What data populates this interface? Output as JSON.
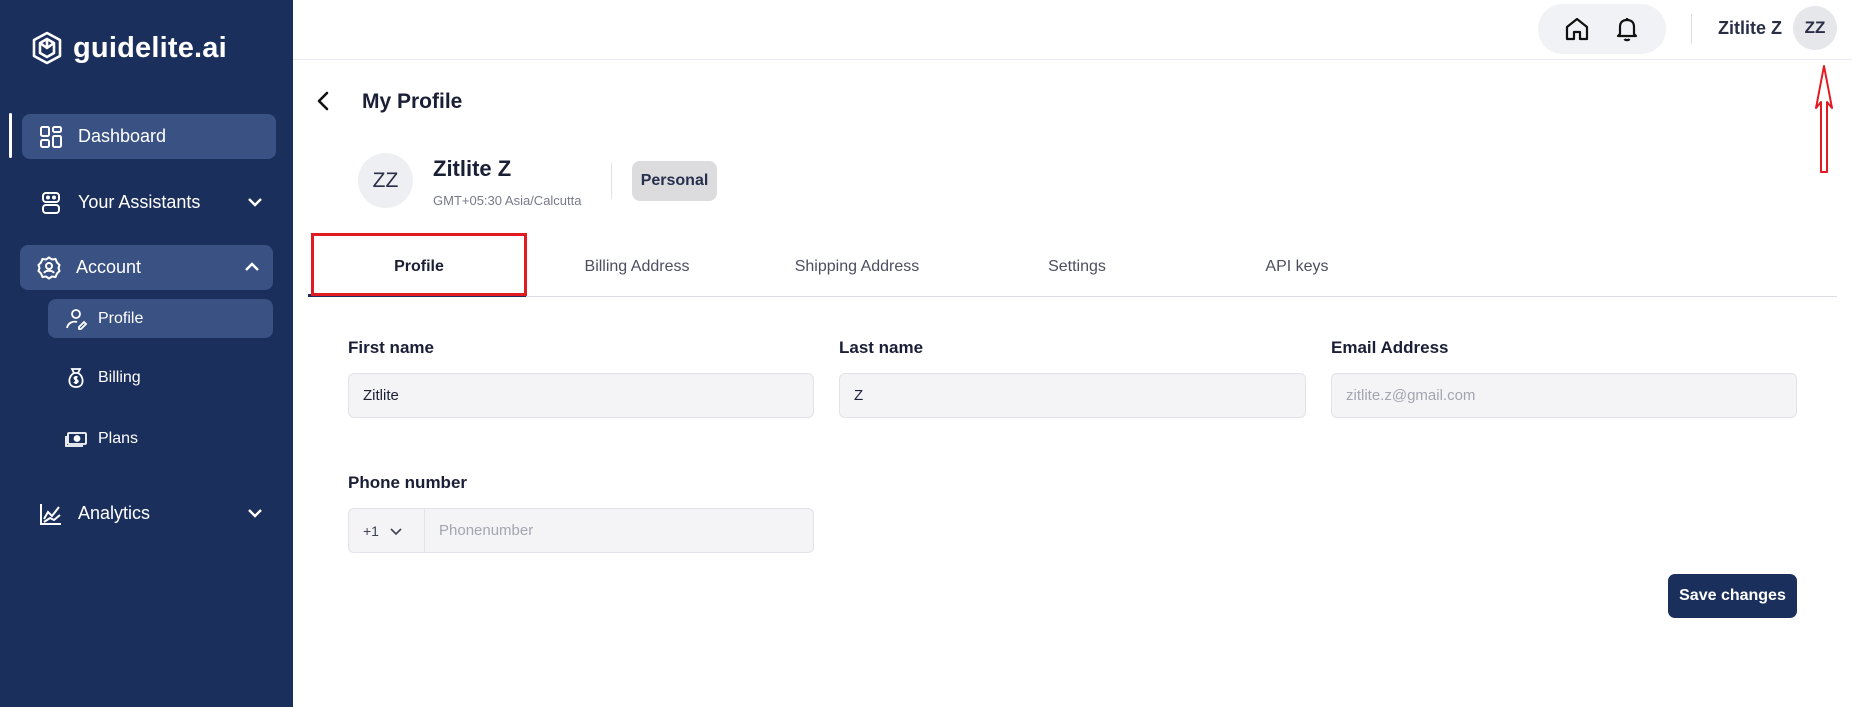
{
  "brand": {
    "name": "guidelite.ai"
  },
  "sidebar": {
    "items": [
      {
        "label": "Dashboard",
        "icon": "dashboard-icon"
      },
      {
        "label": "Your Assistants",
        "icon": "assistant-icon"
      },
      {
        "label": "Account",
        "icon": "account-gear-icon"
      },
      {
        "label": "Analytics",
        "icon": "analytics-icon"
      }
    ],
    "sub_items": [
      {
        "label": "Profile",
        "icon": "profile-icon"
      },
      {
        "label": "Billing",
        "icon": "billing-icon"
      },
      {
        "label": "Plans",
        "icon": "plans-icon"
      }
    ]
  },
  "header": {
    "user_name": "Zitlite Z",
    "avatar_initials": "ZZ"
  },
  "page": {
    "title": "My Profile"
  },
  "profile": {
    "initials": "ZZ",
    "name": "Zitlite Z",
    "timezone": "GMT+05:30 Asia/Calcutta",
    "badge": "Personal"
  },
  "tabs": [
    {
      "label": "Profile",
      "active": true
    },
    {
      "label": "Billing Address"
    },
    {
      "label": "Shipping Address"
    },
    {
      "label": "Settings"
    },
    {
      "label": "API keys"
    }
  ],
  "form": {
    "first_name": {
      "label": "First name",
      "value": "Zitlite"
    },
    "last_name": {
      "label": "Last name",
      "value": "Z"
    },
    "email": {
      "label": "Email Address",
      "placeholder": "zitlite.z@gmail.com"
    },
    "phone": {
      "label": "Phone number",
      "country_code": "+1",
      "placeholder": "Phonenumber"
    },
    "save_label": "Save changes"
  },
  "colors": {
    "sidebar_bg": "#1b2f5c",
    "sidebar_active": "#3a5283",
    "primary": "#1b2f5c",
    "annotation": "#e21b23"
  }
}
